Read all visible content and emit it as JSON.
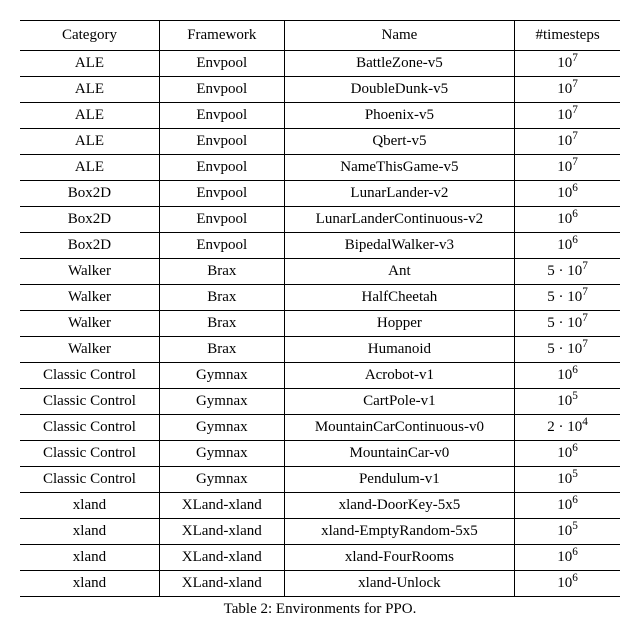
{
  "chart_data": {
    "type": "table",
    "title": "Table 2: Environments for PPO.",
    "columns": [
      "Category",
      "Framework",
      "Name",
      "#timesteps"
    ],
    "rows": [
      {
        "category": "ALE",
        "framework": "Envpool",
        "name": "BattleZone-v5",
        "timesteps_coef": 1,
        "timesteps_exp": 7
      },
      {
        "category": "ALE",
        "framework": "Envpool",
        "name": "DoubleDunk-v5",
        "timesteps_coef": 1,
        "timesteps_exp": 7
      },
      {
        "category": "ALE",
        "framework": "Envpool",
        "name": "Phoenix-v5",
        "timesteps_coef": 1,
        "timesteps_exp": 7
      },
      {
        "category": "ALE",
        "framework": "Envpool",
        "name": "Qbert-v5",
        "timesteps_coef": 1,
        "timesteps_exp": 7
      },
      {
        "category": "ALE",
        "framework": "Envpool",
        "name": "NameThisGame-v5",
        "timesteps_coef": 1,
        "timesteps_exp": 7
      },
      {
        "category": "Box2D",
        "framework": "Envpool",
        "name": "LunarLander-v2",
        "timesteps_coef": 1,
        "timesteps_exp": 6
      },
      {
        "category": "Box2D",
        "framework": "Envpool",
        "name": "LunarLanderContinuous-v2",
        "timesteps_coef": 1,
        "timesteps_exp": 6
      },
      {
        "category": "Box2D",
        "framework": "Envpool",
        "name": "BipedalWalker-v3",
        "timesteps_coef": 1,
        "timesteps_exp": 6
      },
      {
        "category": "Walker",
        "framework": "Brax",
        "name": "Ant",
        "timesteps_coef": 5,
        "timesteps_exp": 7
      },
      {
        "category": "Walker",
        "framework": "Brax",
        "name": "HalfCheetah",
        "timesteps_coef": 5,
        "timesteps_exp": 7
      },
      {
        "category": "Walker",
        "framework": "Brax",
        "name": "Hopper",
        "timesteps_coef": 5,
        "timesteps_exp": 7
      },
      {
        "category": "Walker",
        "framework": "Brax",
        "name": "Humanoid",
        "timesteps_coef": 5,
        "timesteps_exp": 7
      },
      {
        "category": "Classic Control",
        "framework": "Gymnax",
        "name": "Acrobot-v1",
        "timesteps_coef": 1,
        "timesteps_exp": 6
      },
      {
        "category": "Classic Control",
        "framework": "Gymnax",
        "name": "CartPole-v1",
        "timesteps_coef": 1,
        "timesteps_exp": 5
      },
      {
        "category": "Classic Control",
        "framework": "Gymnax",
        "name": "MountainCarContinuous-v0",
        "timesteps_coef": 2,
        "timesteps_exp": 4
      },
      {
        "category": "Classic Control",
        "framework": "Gymnax",
        "name": "MountainCar-v0",
        "timesteps_coef": 1,
        "timesteps_exp": 6
      },
      {
        "category": "Classic Control",
        "framework": "Gymnax",
        "name": "Pendulum-v1",
        "timesteps_coef": 1,
        "timesteps_exp": 5
      },
      {
        "category": "xland",
        "framework": "XLand-xland",
        "name": "xland-DoorKey-5x5",
        "timesteps_coef": 1,
        "timesteps_exp": 6
      },
      {
        "category": "xland",
        "framework": "XLand-xland",
        "name": "xland-EmptyRandom-5x5",
        "timesteps_coef": 1,
        "timesteps_exp": 5
      },
      {
        "category": "xland",
        "framework": "XLand-xland",
        "name": "xland-FourRooms",
        "timesteps_coef": 1,
        "timesteps_exp": 6
      },
      {
        "category": "xland",
        "framework": "XLand-xland",
        "name": "xland-Unlock",
        "timesteps_coef": 1,
        "timesteps_exp": 6
      }
    ]
  }
}
